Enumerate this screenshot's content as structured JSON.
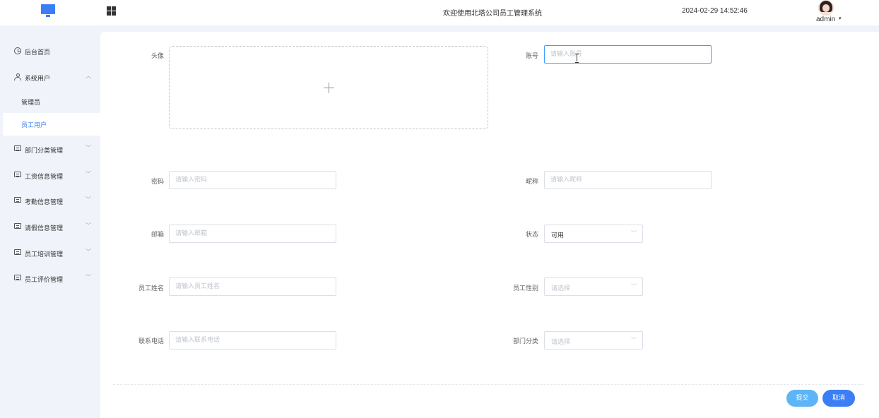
{
  "header": {
    "welcome": "欢迎使用北塔公司员工管理系统",
    "datetime": "2024-02-29 14:52:46",
    "username": "admin",
    "caret": "▾",
    "logo_icon": "monitor-icon",
    "menu_icon": "grid-icon"
  },
  "sidebar": {
    "items": [
      {
        "label": "后台首页",
        "icon": "clock-icon"
      },
      {
        "label": "系统用户",
        "icon": "user-icon",
        "arrow": "︿"
      },
      {
        "label": "部门分类管理",
        "icon": "card-icon",
        "arrow": "﹀"
      },
      {
        "label": "工资信息管理",
        "icon": "card-icon",
        "arrow": "﹀"
      },
      {
        "label": "考勤信息管理",
        "icon": "card-icon",
        "arrow": "﹀"
      },
      {
        "label": "请假信息管理",
        "icon": "card-icon",
        "arrow": "﹀"
      },
      {
        "label": "员工培训管理",
        "icon": "card-icon",
        "arrow": "﹀"
      },
      {
        "label": "员工评价管理",
        "icon": "card-icon",
        "arrow": "﹀"
      }
    ],
    "sub_items": [
      {
        "label": "管理员"
      },
      {
        "label": "员工用户",
        "active": true
      }
    ],
    "active_color": "#3b7ef5"
  },
  "form": {
    "avatar": {
      "label": "头像"
    },
    "account": {
      "label": "账号",
      "placeholder": "请输入账号"
    },
    "password": {
      "label": "密码",
      "placeholder": "请输入密码"
    },
    "nickname": {
      "label": "昵称",
      "placeholder": "请输入昵称"
    },
    "email": {
      "label": "邮箱",
      "placeholder": "请输入邮箱"
    },
    "status": {
      "label": "状态",
      "value": "可用"
    },
    "employee_name": {
      "label": "员工姓名",
      "placeholder": "请输入员工姓名"
    },
    "gender": {
      "label": "员工性别",
      "placeholder": "请选择"
    },
    "phone": {
      "label": "联系电话",
      "placeholder": "请输入联系电话"
    },
    "department": {
      "label": "部门分类",
      "placeholder": "请选择"
    },
    "select_arrow": "﹀"
  },
  "actions": {
    "submit_label": "提交",
    "cancel_label": "取消"
  }
}
